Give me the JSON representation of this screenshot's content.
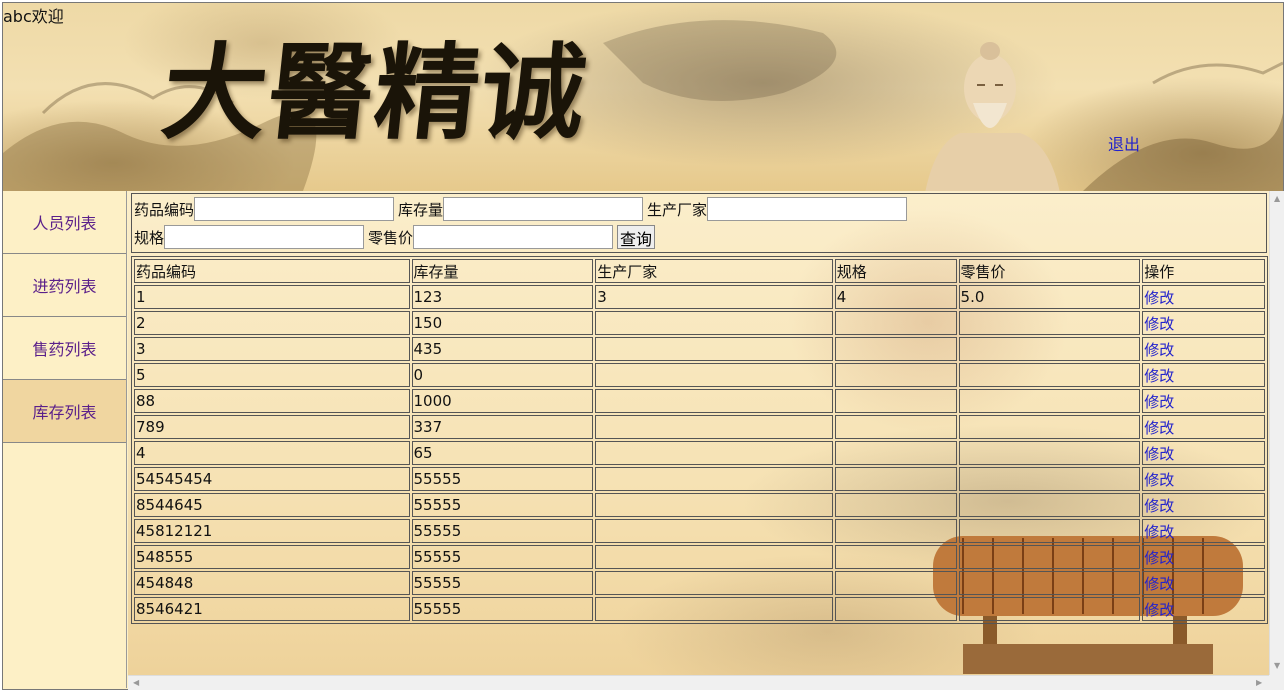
{
  "header": {
    "welcome": "abc欢迎",
    "banner_title": "大醫精诚",
    "logout_label": "退出"
  },
  "sidebar": {
    "items": [
      {
        "label": "人员列表",
        "active": false
      },
      {
        "label": "进药列表",
        "active": false
      },
      {
        "label": "售药列表",
        "active": false
      },
      {
        "label": "库存列表",
        "active": true
      }
    ]
  },
  "search": {
    "fields": {
      "code_label": "药品编码",
      "stock_label": "库存量",
      "maker_label": "生产厂家",
      "spec_label": "规格",
      "price_label": "零售价"
    },
    "values": {
      "code": "",
      "stock": "",
      "maker": "",
      "spec": "",
      "price": ""
    },
    "query_button": "查询"
  },
  "table": {
    "headers": [
      "药品编码",
      "库存量",
      "生产厂家",
      "规格",
      "零售价",
      "操作"
    ],
    "edit_label": "修改",
    "rows": [
      [
        "1",
        "123",
        "3",
        "4",
        "5.0"
      ],
      [
        "2",
        "150",
        "",
        "",
        ""
      ],
      [
        "3",
        "435",
        "",
        "",
        ""
      ],
      [
        "5",
        "0",
        "",
        "",
        ""
      ],
      [
        "88",
        "1000",
        "",
        "",
        ""
      ],
      [
        "789",
        "337",
        "",
        "",
        ""
      ],
      [
        "4",
        "65",
        "",
        "",
        ""
      ],
      [
        "54545454",
        "55555",
        "",
        "",
        ""
      ],
      [
        "8544645",
        "55555",
        "",
        "",
        ""
      ],
      [
        "45812121",
        "55555",
        "",
        "",
        ""
      ],
      [
        "548555",
        "55555",
        "",
        "",
        ""
      ],
      [
        "454848",
        "55555",
        "",
        "",
        ""
      ],
      [
        "8546421",
        "55555",
        "",
        "",
        ""
      ]
    ]
  },
  "colors": {
    "link": "#2222cc",
    "nav_text": "#5a1f8a",
    "background": "#fdf0c6",
    "active_nav": "#f0d6a0"
  }
}
